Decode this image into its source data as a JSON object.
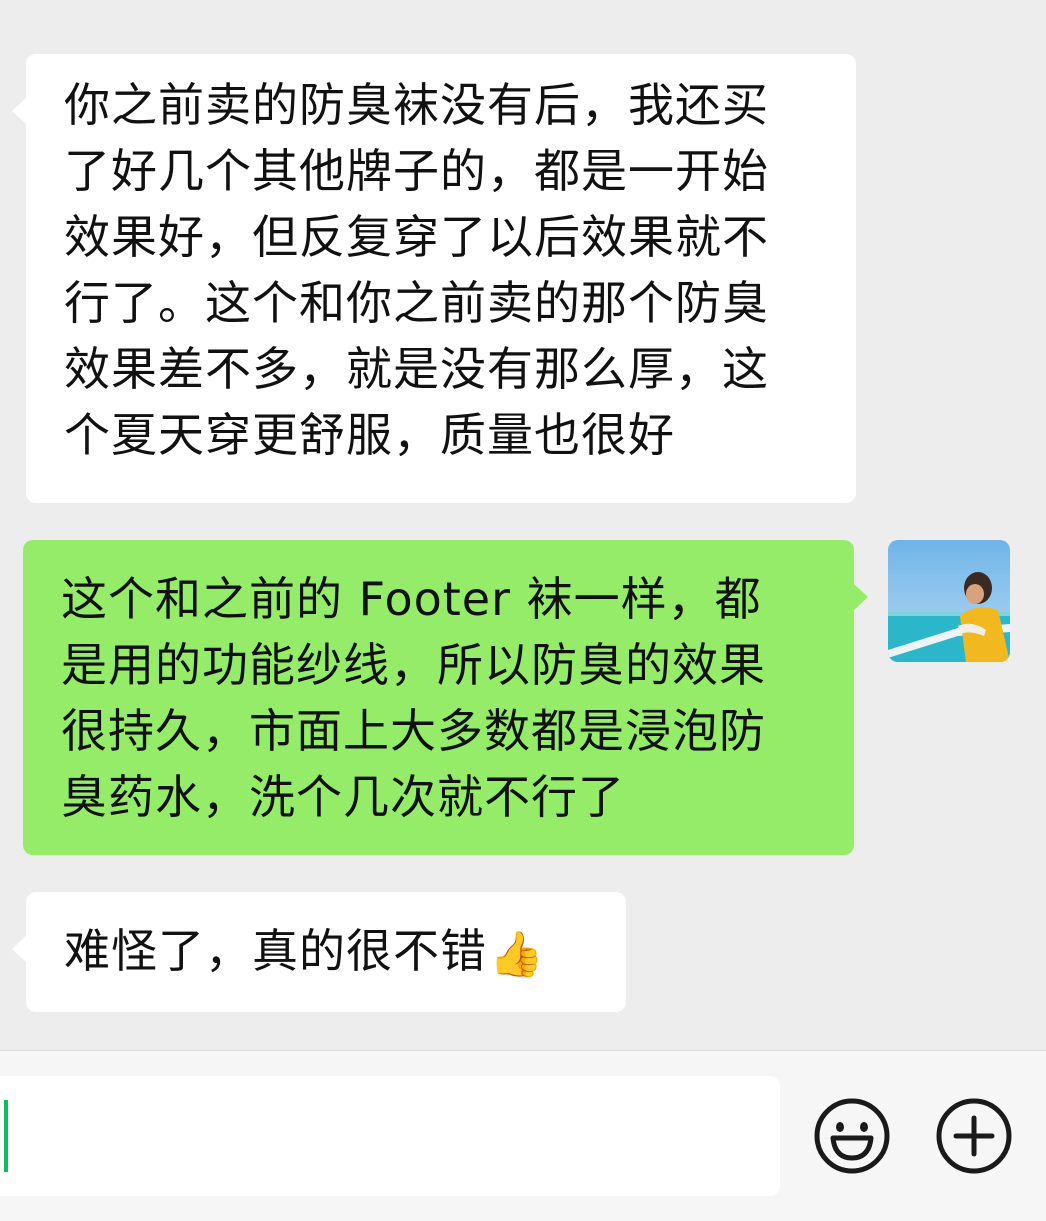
{
  "conversation": {
    "messages": [
      {
        "side": "left",
        "lines": [
          "你之前卖的防臭袜没有后，我还买",
          "了好几个其他牌子的，都是一开始",
          "效果好，但反复穿了以后效果就不",
          "行了。这个和你之前卖的那个防臭",
          "效果差不多，就是没有那么厚，这",
          "个夏天穿更舒服，质量也很好"
        ]
      },
      {
        "side": "right",
        "lines": [
          "这个和之前的 Footer 袜一样，都",
          "是用的功能纱线，所以防臭的效果",
          "很持久，市面上大多数都是浸泡防",
          "臭药水，洗个几次就不行了"
        ]
      },
      {
        "side": "left",
        "lines": [
          "难怪了，真的很不错"
        ],
        "emoji": "👍"
      }
    ]
  },
  "input": {
    "value": "",
    "placeholder": ""
  },
  "icons": {
    "emoji_button": "smiley-face-icon",
    "more_button": "plus-circle-icon"
  },
  "colors": {
    "chat_background": "#ededed",
    "incoming_bubble": "#ffffff",
    "outgoing_bubble": "#95ec69",
    "caret": "#07c160"
  }
}
